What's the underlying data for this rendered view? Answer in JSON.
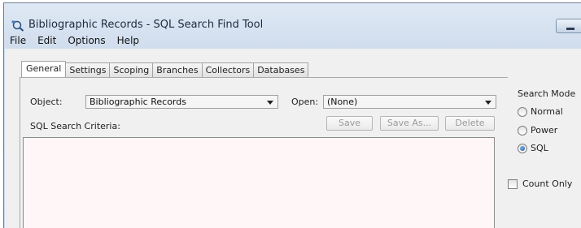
{
  "window": {
    "title": "Bibliographic Records - SQL Search Find Tool"
  },
  "menu": [
    "File",
    "Edit",
    "Options",
    "Help"
  ],
  "tabs": [
    {
      "label": "General",
      "active": true
    },
    {
      "label": "Settings",
      "active": false
    },
    {
      "label": "Scoping",
      "active": false
    },
    {
      "label": "Branches",
      "active": false
    },
    {
      "label": "Collectors",
      "active": false
    },
    {
      "label": "Databases",
      "active": false
    }
  ],
  "form": {
    "object_label": "Object:",
    "object_value": "Bibliographic Records",
    "open_label": "Open:",
    "open_value": "(None)",
    "criteria_label": "SQL Search Criteria:",
    "criteria_value": "",
    "save_label": "Save",
    "save_as_label": "Save As...",
    "delete_label": "Delete"
  },
  "search_mode": {
    "title": "Search Mode",
    "options": [
      {
        "label": "Normal",
        "selected": false
      },
      {
        "label": "Power",
        "selected": false
      },
      {
        "label": "SQL",
        "selected": true
      }
    ]
  },
  "count_only": {
    "label": "Count Only",
    "checked": false
  },
  "icons": {
    "app": "search-tool-icon",
    "dropdown": "chevron-down-icon"
  }
}
